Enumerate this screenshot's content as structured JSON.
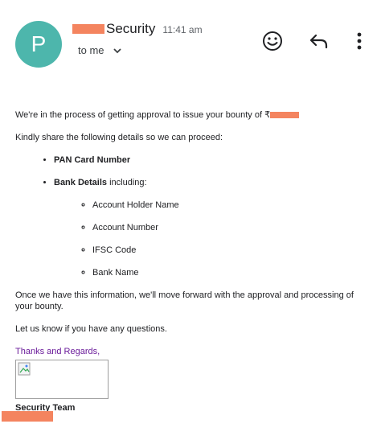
{
  "header": {
    "avatar_letter": "P",
    "sender_name": "Security",
    "time": "11:41 am",
    "to_label": "to me"
  },
  "icons": {
    "avatar_color": "#4db6ac",
    "redaction_color": "#f4845f",
    "emoji": "smiley-icon",
    "reply": "reply-arrow-icon",
    "more": "vertical-dots-icon",
    "chevron": "chevron-down-icon"
  },
  "email": {
    "line1": "We're in the process of getting approval to issue your bounty of ₹",
    "line2": "Kindly share the following details so we can proceed:",
    "item1": "PAN Card Number",
    "item2_bold": "Bank Details",
    "item2_rest": " including:",
    "sub_items": [
      "Account Holder Name",
      "Account Number",
      "IFSC Code",
      "Bank Name"
    ],
    "closing1": "Once we have this information, we'll move forward with the approval and processing of your bounty.",
    "closing2": "Let us know if you have any questions.",
    "thanks": "Thanks and Regards,",
    "team": "Security Team"
  }
}
